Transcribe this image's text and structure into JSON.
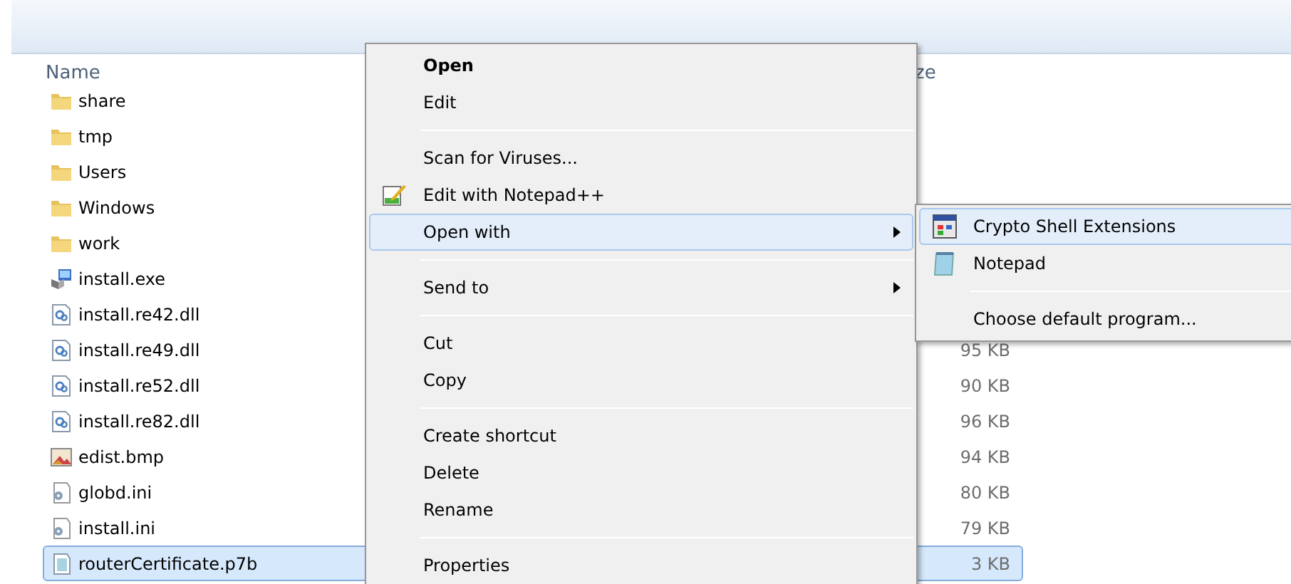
{
  "columns": [
    "Name",
    "ze"
  ],
  "files": [
    {
      "name": "share",
      "kind": "folder",
      "selected": false
    },
    {
      "name": "tmp",
      "kind": "folder",
      "selected": false
    },
    {
      "name": "Users",
      "kind": "folder",
      "selected": false
    },
    {
      "name": "Windows",
      "kind": "folder",
      "selected": false
    },
    {
      "name": "work",
      "kind": "folder",
      "selected": false
    },
    {
      "name": "install.exe",
      "kind": "exe",
      "selected": false
    },
    {
      "name": "install.re42.dll",
      "kind": "dll",
      "selected": false
    },
    {
      "name": "install.re49.dll",
      "kind": "dll",
      "size": "95 KB",
      "selected": false
    },
    {
      "name": "install.re52.dll",
      "kind": "dll",
      "size": "90 KB",
      "selected": false
    },
    {
      "name": "install.re82.dll",
      "kind": "dll",
      "size": "96 KB",
      "selected": false
    },
    {
      "name": "edist.bmp",
      "kind": "bmp",
      "size": "94 KB",
      "selected": false
    },
    {
      "name": "globd.ini",
      "kind": "ini",
      "size": "80 KB",
      "selected": false
    },
    {
      "name": "install.ini",
      "kind": "ini",
      "size": "79 KB",
      "selected": false
    },
    {
      "name": "routerCertificate.p7b",
      "kind": "cert",
      "size": "3 KB",
      "selected": true
    }
  ],
  "context_menu": {
    "groups": [
      [
        {
          "label": "Open",
          "default": true,
          "selected": false,
          "submenu": false
        },
        {
          "label": "Edit",
          "default": false,
          "selected": false,
          "submenu": false
        }
      ],
      [
        {
          "label": "Scan for Viruses...",
          "default": false,
          "selected": false,
          "submenu": false
        },
        {
          "label": "Edit with Notepad++",
          "default": false,
          "selected": false,
          "submenu": false
        },
        {
          "label": "Open with",
          "default": false,
          "selected": true,
          "submenu": true
        }
      ],
      [
        {
          "label": "Send to",
          "default": false,
          "selected": false,
          "submenu": true
        }
      ],
      [
        {
          "label": "Cut",
          "default": false,
          "selected": false,
          "submenu": false
        },
        {
          "label": "Copy",
          "default": false,
          "selected": false,
          "submenu": false
        }
      ],
      [
        {
          "label": "Create shortcut",
          "default": false,
          "selected": false,
          "submenu": false
        },
        {
          "label": "Delete",
          "default": false,
          "selected": false,
          "submenu": false
        },
        {
          "label": "Rename",
          "default": false,
          "selected": false,
          "submenu": false
        }
      ],
      [
        {
          "label": "Properties",
          "default": false,
          "selected": false,
          "submenu": false
        }
      ]
    ]
  },
  "submenu": {
    "groups": [
      [
        {
          "label": "Crypto Shell Extensions",
          "selected": true
        },
        {
          "label": "Notepad",
          "selected": false
        }
      ],
      [
        {
          "label": "Choose default program...",
          "selected": false
        }
      ]
    ]
  }
}
